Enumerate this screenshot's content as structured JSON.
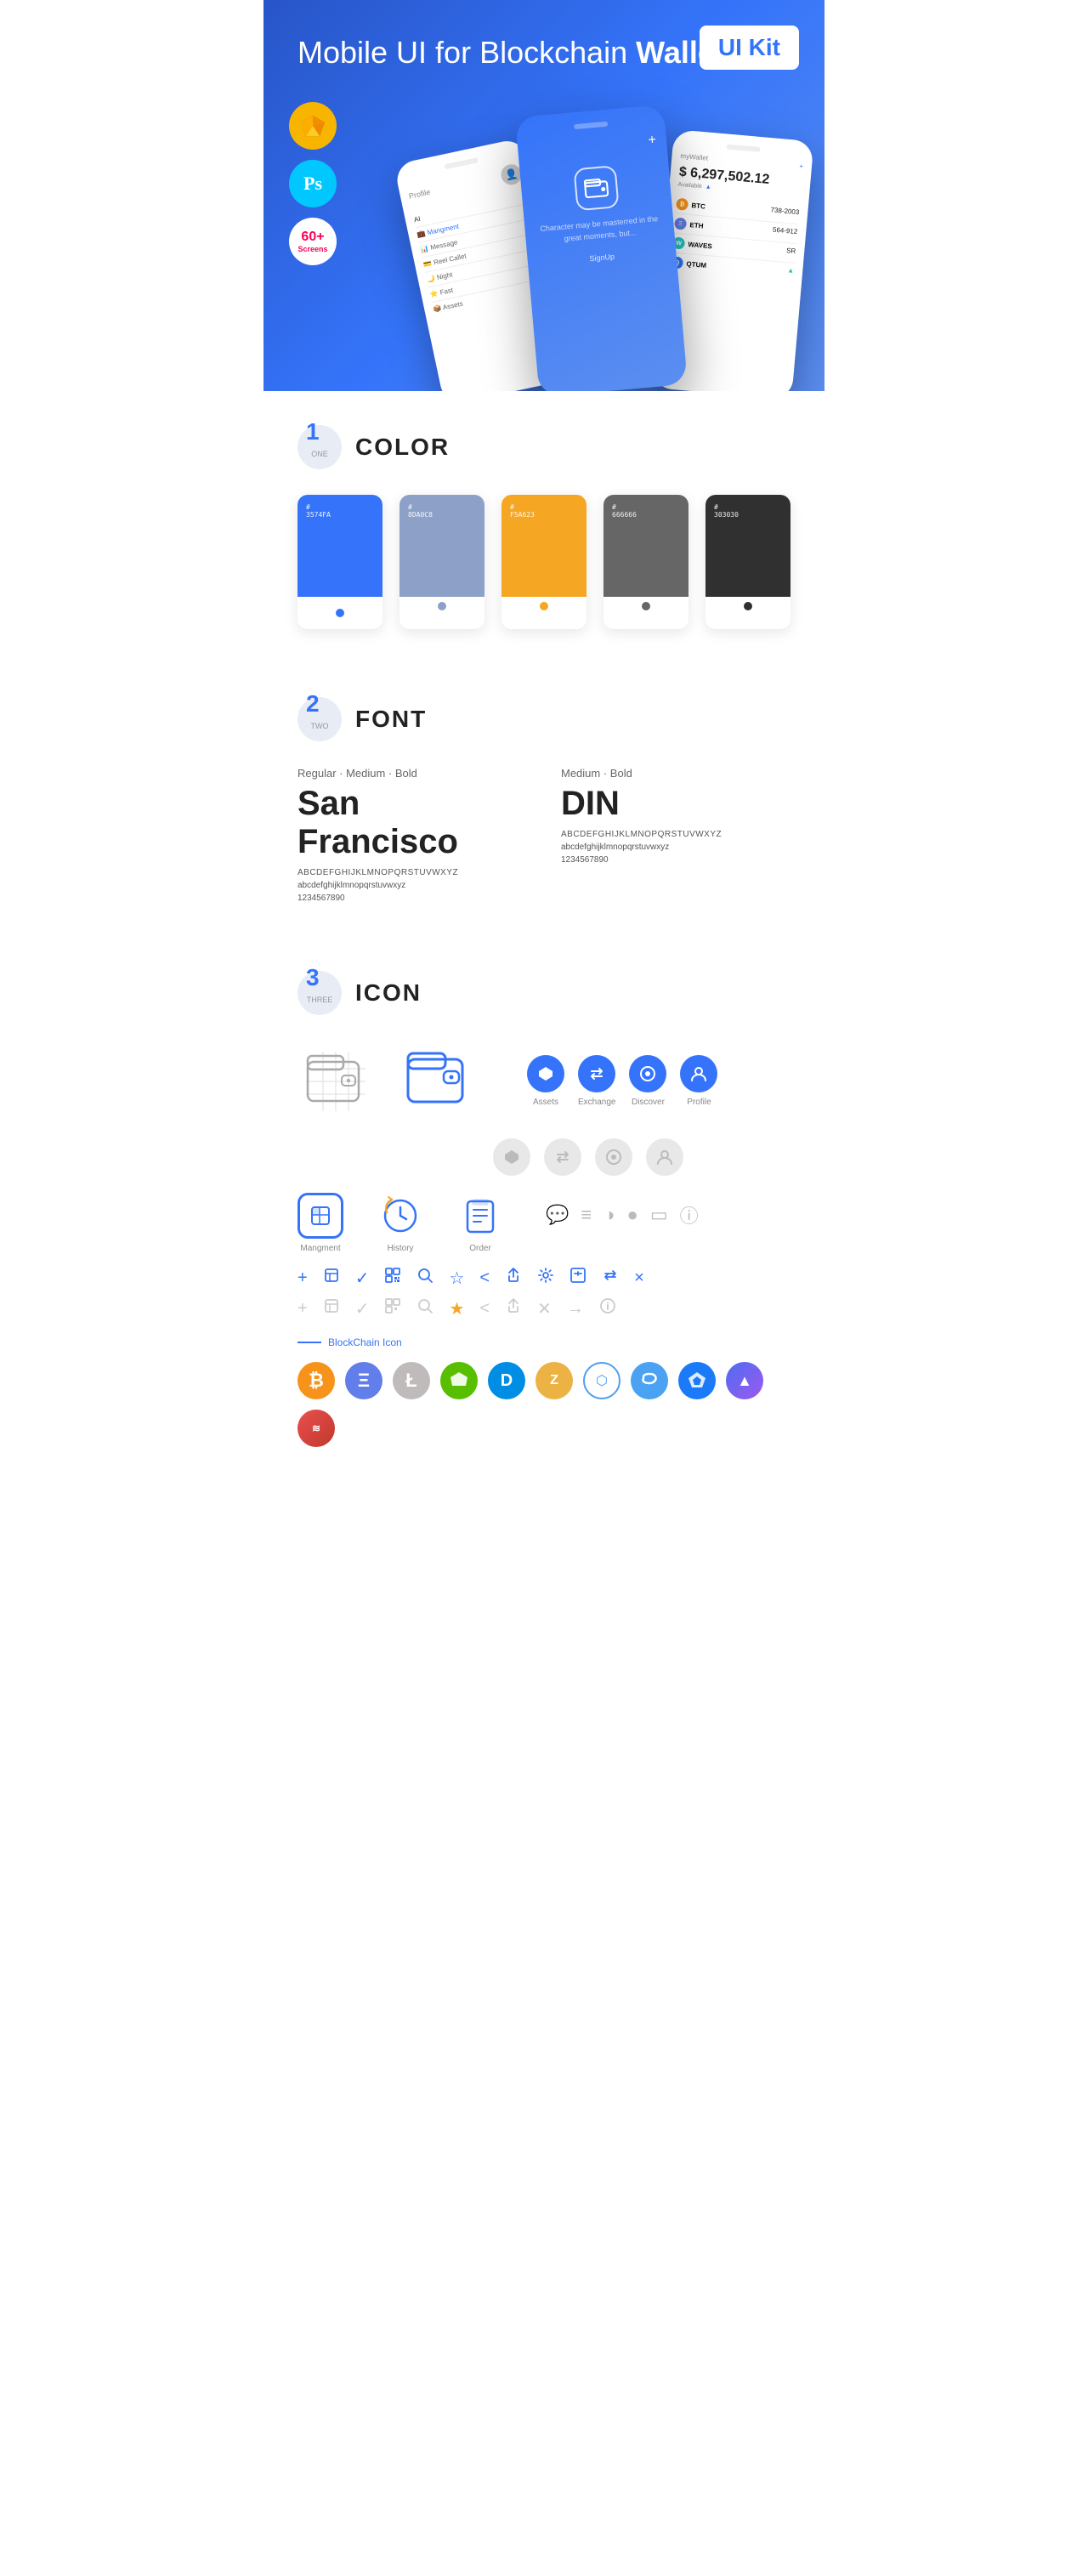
{
  "hero": {
    "title": "Mobile UI for Blockchain ",
    "title_bold": "Wallet",
    "badge": "UI Kit",
    "badges": [
      {
        "id": "sketch",
        "label": "Sketch",
        "symbol": "◆"
      },
      {
        "id": "ps",
        "label": "Ps"
      },
      {
        "id": "screens",
        "num": "60+",
        "word": "Screens"
      }
    ]
  },
  "sections": {
    "color": {
      "number": "1",
      "word": "ONE",
      "title": "COLOR",
      "colors": [
        {
          "hex": "#3574FA",
          "code": "#\n3574FA"
        },
        {
          "hex": "#8DA0C8",
          "code": "#\n8DA0C8"
        },
        {
          "hex": "#F5A623",
          "code": "#\nF5A623"
        },
        {
          "hex": "#666666",
          "code": "#\n666666"
        },
        {
          "hex": "#303030",
          "code": "#\n303030"
        }
      ]
    },
    "font": {
      "number": "2",
      "word": "TWO",
      "title": "FONT",
      "fonts": [
        {
          "style_label": "Regular · Medium · Bold",
          "name": "San Francisco",
          "upper": "ABCDEFGHIJKLMNOPQRSTUVWXYZ",
          "lower": "abcdefghijklmnopqrstuvwxyz",
          "numbers": "1234567890"
        },
        {
          "style_label": "Medium · Bold",
          "name": "DIN",
          "upper": "ABCDEFGHIJKLMNOPQRSTUVWXYZ",
          "lower": "abcdefghijklmnopqrstuvwxyz",
          "numbers": "1234567890"
        }
      ]
    },
    "icon": {
      "number": "3",
      "word": "THREE",
      "title": "ICON",
      "nav_icons": [
        {
          "label": "Assets",
          "symbol": "◆"
        },
        {
          "label": "Exchange",
          "symbol": "⇄"
        },
        {
          "label": "Discover",
          "symbol": "◉"
        },
        {
          "label": "Profile",
          "symbol": "◔"
        }
      ],
      "bottom_nav": [
        {
          "label": "Mangment"
        },
        {
          "label": "History"
        },
        {
          "label": "Order"
        }
      ],
      "toolbar_icons": [
        "+",
        "⊞",
        "✓",
        "⊞",
        "🔍",
        "☆",
        "<",
        "<",
        "⚙",
        "⊡",
        "⇄",
        "×"
      ],
      "blockchain_label": "BlockChain Icon",
      "cryptos": [
        {
          "symbol": "₿",
          "class": "crypto-btc",
          "label": "Bitcoin"
        },
        {
          "symbol": "Ξ",
          "class": "crypto-eth",
          "label": "Ethereum"
        },
        {
          "symbol": "Ł",
          "class": "crypto-ltc",
          "label": "Litecoin"
        },
        {
          "symbol": "N",
          "class": "crypto-neo",
          "label": "NEO"
        },
        {
          "symbol": "D",
          "class": "crypto-dash",
          "label": "Dash"
        },
        {
          "symbol": "Z",
          "class": "crypto-zcash",
          "label": "Zcash"
        },
        {
          "symbol": "⬡",
          "class": "crypto-grid",
          "label": "Grid"
        },
        {
          "symbol": "S",
          "class": "crypto-steem",
          "label": "Steem"
        },
        {
          "symbol": "K",
          "class": "crypto-kyber",
          "label": "Kyber"
        },
        {
          "symbol": "▲",
          "class": "crypto-band",
          "label": "Band"
        },
        {
          "symbol": "≋",
          "class": "crypto-kava",
          "label": "Kava"
        }
      ]
    }
  }
}
